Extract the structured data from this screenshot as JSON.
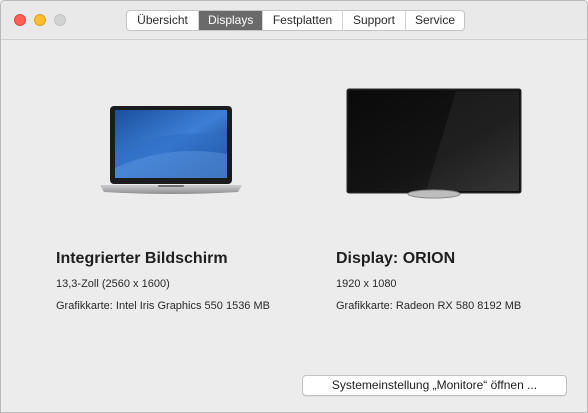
{
  "tabs": [
    {
      "label": "Übersicht",
      "active": false
    },
    {
      "label": "Displays",
      "active": true
    },
    {
      "label": "Festplatten",
      "active": false
    },
    {
      "label": "Support",
      "active": false
    },
    {
      "label": "Service",
      "active": false
    }
  ],
  "displays": [
    {
      "name": "Integrierter Bildschirm",
      "resolution": "13,3-Zoll (2560 x 1600)",
      "graphics": "Grafikkarte: Intel Iris Graphics 550 1536 MB",
      "icon": "laptop-icon"
    },
    {
      "name": "Display: ORION",
      "resolution": "1920 x 1080",
      "graphics": "Grafikkarte: Radeon RX 580 8192 MB",
      "icon": "monitor-icon"
    }
  ],
  "footer": {
    "button_label": "Systemeinstellung „Monitore“ öffnen ..."
  },
  "colors": {
    "active_tab": "#6a6a6a",
    "close": "#fe5f57",
    "minimize": "#febc2e",
    "maximize": "#d3d3d3"
  }
}
